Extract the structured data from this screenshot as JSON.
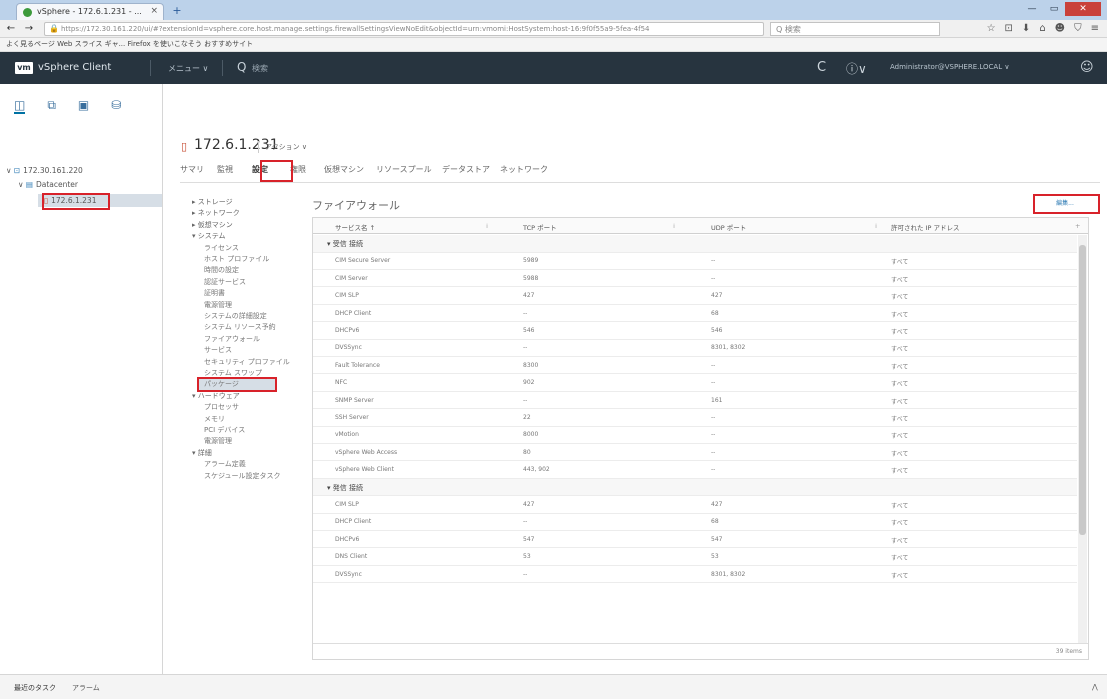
{
  "browser": {
    "tab_title": "vSphere - 172.6.1.231 - ...",
    "tab_close": "×",
    "new_tab": "+",
    "back": "←",
    "forward": "→",
    "url": "https://172.30.161.220/ui/#?extensionId=vsphere.core.host.manage.settings.firewallSettingsViewNoEdit&objectId=urn:vmomi:HostSystem:host-16:9f0f55a9-5fea-4f54",
    "zoom": "☆ | Q 検索",
    "search_placeholder": "Q 検索",
    "bookmarks": "よく見るページ  Web スライス ギャ...  Firefox を使いこなそう  おすすめサイト",
    "tool_icons": [
      "☆",
      "⊡",
      "⬇",
      "⌂",
      "☻",
      "⛉",
      "≡"
    ],
    "win_min": "—",
    "win_max": "▭",
    "win_close": "✕"
  },
  "vsphere": {
    "logo": "vm",
    "title": "vSphere Client",
    "menu": "メニュー ∨",
    "search_icon": "Q",
    "search_text": "検索",
    "refresh_icon": "C",
    "help_icon": "ⓘ∨",
    "user": "Administrator@VSPHERE.LOCAL ∨",
    "smiley_icon": "☺"
  },
  "navigator": {
    "icons": [
      "◫",
      "⧉",
      "▣",
      "⛁"
    ],
    "tree": [
      {
        "label": "172.30.161.220",
        "icon": "⊡"
      },
      {
        "label": "Datacenter",
        "icon": "▤"
      },
      {
        "label": "172.6.1.231",
        "icon": "▯"
      }
    ]
  },
  "object": {
    "icon": "▯",
    "title": "172.6.1.231",
    "actions": "アクション ∨"
  },
  "tabs": [
    "サマリ",
    "監視",
    "設定",
    "権限",
    "仮想マシン",
    "リソースプール",
    "データストア",
    "ネットワーク"
  ],
  "settings_menu": [
    "▸ ストレージ",
    "▸ ネットワーク",
    "▸ 仮想マシン",
    "▾ システム",
    "ライセンス",
    "ホスト プロファイル",
    "時間の設定",
    "認証サービス",
    "証明書",
    "電源管理",
    "システムの詳細設定",
    "システム リソース予約",
    "ファイアウォール",
    "サービス",
    "セキュリティ プロファイル",
    "システム スワップ",
    "パッケージ",
    "▾ ハードウェア",
    "プロセッサ",
    "メモリ",
    "PCI デバイス",
    "電源管理",
    "▾ 詳細",
    "アラーム定義",
    "スケジュール設定タスク"
  ],
  "content": {
    "section_title": "ファイアウォール",
    "edit_label": "編集...",
    "columns": [
      "サービス名 ↑",
      "TCP ポート",
      "UDP ポート",
      "許可された IP アドレス"
    ],
    "rows": [
      {
        "group": true,
        "name": "▾ 受信 接続"
      },
      {
        "name": "CIM Secure Server",
        "tcp": "5989",
        "udp": "--",
        "ip": "すべて"
      },
      {
        "name": "CIM Server",
        "tcp": "5988",
        "udp": "--",
        "ip": "すべて"
      },
      {
        "name": "CIM SLP",
        "tcp": "427",
        "udp": "427",
        "ip": "すべて"
      },
      {
        "name": "DHCP Client",
        "tcp": "--",
        "udp": "68",
        "ip": "すべて"
      },
      {
        "name": "DHCPv6",
        "tcp": "546",
        "udp": "546",
        "ip": "すべて"
      },
      {
        "name": "DVSSync",
        "tcp": "--",
        "udp": "8301, 8302",
        "ip": "すべて"
      },
      {
        "name": "Fault Tolerance",
        "tcp": "8300",
        "udp": "--",
        "ip": "すべて"
      },
      {
        "name": "NFC",
        "tcp": "902",
        "udp": "--",
        "ip": "すべて"
      },
      {
        "name": "SNMP Server",
        "tcp": "--",
        "udp": "161",
        "ip": "すべて"
      },
      {
        "name": "SSH Server",
        "tcp": "22",
        "udp": "--",
        "ip": "すべて"
      },
      {
        "name": "vMotion",
        "tcp": "8000",
        "udp": "--",
        "ip": "すべて"
      },
      {
        "name": "vSphere Web Access",
        "tcp": "80",
        "udp": "--",
        "ip": "すべて"
      },
      {
        "name": "vSphere Web Client",
        "tcp": "443, 902",
        "udp": "--",
        "ip": "すべて"
      },
      {
        "group": true,
        "name": "▾ 発信 接続"
      },
      {
        "name": "CIM SLP",
        "tcp": "427",
        "udp": "427",
        "ip": "すべて"
      },
      {
        "name": "DHCP Client",
        "tcp": "--",
        "udp": "68",
        "ip": "すべて"
      },
      {
        "name": "DHCPv6",
        "tcp": "547",
        "udp": "547",
        "ip": "すべて"
      },
      {
        "name": "DNS Client",
        "tcp": "53",
        "udp": "53",
        "ip": "すべて"
      },
      {
        "name": "DVSSync",
        "tcp": "--",
        "udp": "8301, 8302",
        "ip": "すべて"
      }
    ],
    "count": "39 items"
  },
  "bottom": {
    "recent_tasks": "最近のタスク",
    "alarms": "アラーム",
    "expand_icon": "⋀"
  }
}
